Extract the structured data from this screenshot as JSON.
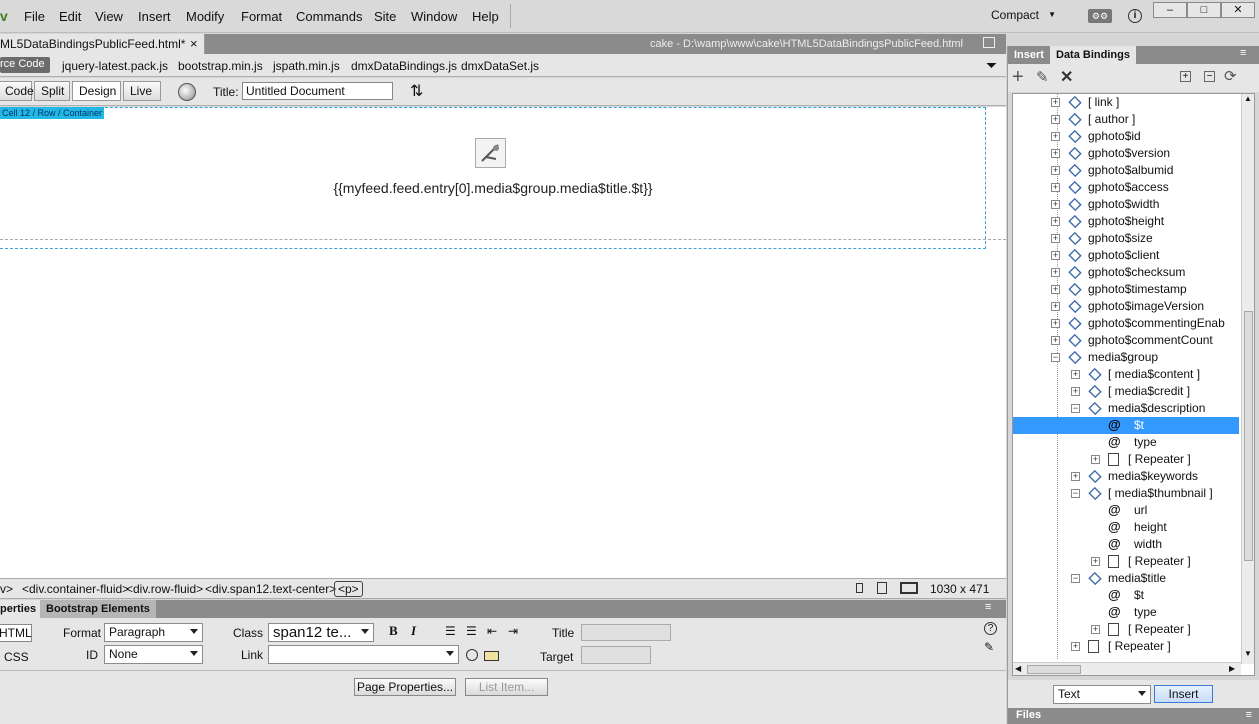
{
  "menubar": {
    "logo": "v",
    "items": [
      "File",
      "Edit",
      "View",
      "Insert",
      "Modify",
      "Format",
      "Commands",
      "Site",
      "Window",
      "Help"
    ],
    "workspace": "Compact",
    "sync_icon": "sync-settings-icon",
    "help_icon": "info-icon",
    "min": "–",
    "max": "□",
    "close": "✕"
  },
  "document": {
    "tab_name": "ML5DataBindingsPublicFeed.html*",
    "close": "×",
    "path": "cake - D:\\wamp\\www\\cake\\HTML5DataBindingsPublicFeed.html",
    "related_files": [
      "rce Code",
      "jquery-latest.pack.js",
      "bootstrap.min.js",
      "jspath.min.js",
      "dmxDataBindings.js",
      "dmxDataSet.js"
    ]
  },
  "doc_toolbar": {
    "views": [
      "Code",
      "Split",
      "Design",
      "Live"
    ],
    "active_view": "Design",
    "title_label": "Title:",
    "title_value": "Untitled Document"
  },
  "design": {
    "tag_tip": "Cell 12 / Row / Container",
    "binding_text": "{{myfeed.feed.entry[0].media$group.media$title.$t}}"
  },
  "status": {
    "breadcrumb": [
      "v>",
      "<div.container-fluid>",
      "<div.row-fluid>",
      "<div.span12.text-center>",
      "<p>"
    ],
    "size": "1030 x 471"
  },
  "properties": {
    "tabs": [
      "perties",
      "Bootstrap Elements"
    ],
    "html_btn": "HTML",
    "css_btn": "CSS",
    "format_label": "Format",
    "format_value": "Paragraph",
    "class_label": "Class",
    "class_value": "span12 te...",
    "id_label": "ID",
    "id_value": "None",
    "link_label": "Link",
    "link_value": "",
    "bold": "B",
    "italic": "I",
    "title_label": "Title",
    "target_label": "Target",
    "page_properties": "Page Properties...",
    "list_item": "List Item..."
  },
  "panel": {
    "tabs": [
      "Insert",
      "Data Bindings"
    ],
    "active_tab": "Data Bindings",
    "tree": [
      {
        "label": "[ link ]",
        "level": 0,
        "icon": "obj-plus",
        "exp": "+"
      },
      {
        "label": "[ author ]",
        "level": 0,
        "icon": "obj-plus",
        "exp": "+"
      },
      {
        "label": "gphoto$id",
        "level": 0,
        "icon": "obj",
        "exp": "+"
      },
      {
        "label": "gphoto$version",
        "level": 0,
        "icon": "obj",
        "exp": "+"
      },
      {
        "label": "gphoto$albumid",
        "level": 0,
        "icon": "obj",
        "exp": "+"
      },
      {
        "label": "gphoto$access",
        "level": 0,
        "icon": "obj",
        "exp": "+"
      },
      {
        "label": "gphoto$width",
        "level": 0,
        "icon": "obj",
        "exp": "+"
      },
      {
        "label": "gphoto$height",
        "level": 0,
        "icon": "obj",
        "exp": "+"
      },
      {
        "label": "gphoto$size",
        "level": 0,
        "icon": "obj",
        "exp": "+"
      },
      {
        "label": "gphoto$client",
        "level": 0,
        "icon": "obj",
        "exp": "+"
      },
      {
        "label": "gphoto$checksum",
        "level": 0,
        "icon": "obj",
        "exp": "+"
      },
      {
        "label": "gphoto$timestamp",
        "level": 0,
        "icon": "obj",
        "exp": "+"
      },
      {
        "label": "gphoto$imageVersion",
        "level": 0,
        "icon": "obj",
        "exp": "+"
      },
      {
        "label": "gphoto$commentingEnab",
        "level": 0,
        "icon": "obj",
        "exp": "+"
      },
      {
        "label": "gphoto$commentCount",
        "level": 0,
        "icon": "obj",
        "exp": "+"
      },
      {
        "label": "media$group",
        "level": 0,
        "icon": "obj",
        "exp": "−"
      },
      {
        "label": "[ media$content ]",
        "level": 1,
        "icon": "obj-plus",
        "exp": "+"
      },
      {
        "label": "[ media$credit ]",
        "level": 1,
        "icon": "obj-plus",
        "exp": "+"
      },
      {
        "label": "media$description",
        "level": 1,
        "icon": "obj",
        "exp": "−"
      },
      {
        "label": "$t",
        "level": 2,
        "icon": "at",
        "exp": "",
        "selected": true
      },
      {
        "label": "type",
        "level": 2,
        "icon": "at",
        "exp": ""
      },
      {
        "label": "[ Repeater ]",
        "level": 2,
        "icon": "doc",
        "exp": "+"
      },
      {
        "label": "media$keywords",
        "level": 1,
        "icon": "obj",
        "exp": "+"
      },
      {
        "label": "[ media$thumbnail ]",
        "level": 1,
        "icon": "obj-plus",
        "exp": "−"
      },
      {
        "label": "url",
        "level": 2,
        "icon": "at",
        "exp": ""
      },
      {
        "label": "height",
        "level": 2,
        "icon": "at",
        "exp": ""
      },
      {
        "label": "width",
        "level": 2,
        "icon": "at",
        "exp": ""
      },
      {
        "label": "[ Repeater ]",
        "level": 2,
        "icon": "doc",
        "exp": "+"
      },
      {
        "label": "media$title",
        "level": 1,
        "icon": "obj",
        "exp": "−"
      },
      {
        "label": "$t",
        "level": 2,
        "icon": "at",
        "exp": ""
      },
      {
        "label": "type",
        "level": 2,
        "icon": "at",
        "exp": ""
      },
      {
        "label": "[ Repeater ]",
        "level": 2,
        "icon": "doc",
        "exp": "+"
      },
      {
        "label": "[ Repeater ]",
        "level": 1,
        "icon": "doc",
        "exp": "+"
      }
    ],
    "insert_as": "Text",
    "insert_btn": "Insert",
    "files_label": "Files"
  },
  "colors": {
    "selection": "#3399ff",
    "tagtip": "#22b8e6",
    "panel_bar": "#8b8b8b"
  }
}
